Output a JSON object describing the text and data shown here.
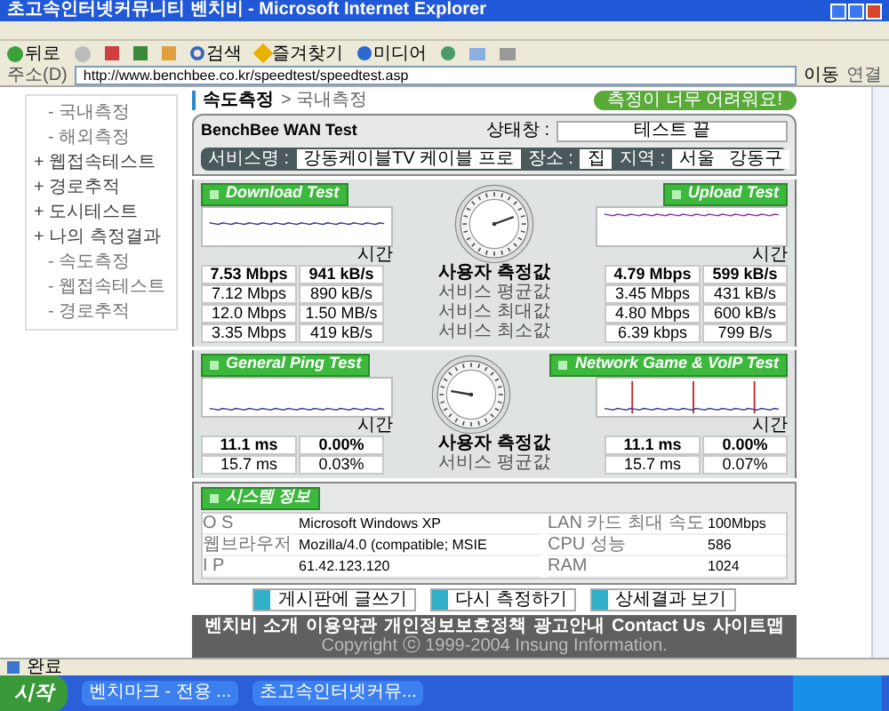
{
  "window": {
    "title": "초고속인터넷커뮤니티 벤치비 - Microsoft Internet Explorer"
  },
  "toolbar": {
    "back": "뒤로",
    "search": "검색",
    "favorites": "즐겨찾기",
    "media": "미디어"
  },
  "address": {
    "label": "주소(D)",
    "url": "http://www.benchbee.co.kr/speedtest/speedtest.asp",
    "go": "이동",
    "links": "연결"
  },
  "sidebar": {
    "items": [
      {
        "label": "- 국내측정",
        "kind": "sub"
      },
      {
        "label": "- 해외측정",
        "kind": "sub"
      },
      {
        "label": "+ 웹접속테스트",
        "kind": "section"
      },
      {
        "label": "+ 경로추적",
        "kind": "section"
      },
      {
        "label": "+ 도시테스트",
        "kind": "section"
      },
      {
        "label": "+ 나의 측정결과",
        "kind": "section"
      },
      {
        "label": "- 속도측정",
        "kind": "sub"
      },
      {
        "label": "- 웹접속테스트",
        "kind": "sub"
      },
      {
        "label": "- 경로추적",
        "kind": "sub"
      }
    ]
  },
  "breadcrumb": {
    "section": "속도측정",
    "current": "> 국내측정"
  },
  "help_button": "측정이 너무 어려워요!",
  "wan_test": {
    "title": "BenchBee WAN Test",
    "status_label": "상태창 :",
    "status": "테스트 끝",
    "service_label": "서비스명 :",
    "service": "강동케이블TV 케이블 프로",
    "place_label": "장소 :",
    "place": "집",
    "region_label": "지역 :",
    "city": "서울",
    "district": "강동구"
  },
  "speed": {
    "left_tab": "Download Test",
    "right_tab": "Upload Test",
    "x_label_left": "시간",
    "x_label_right": "시간",
    "rows": [
      {
        "left_a": "7.53 Mbps",
        "left_b": "941 kB/s",
        "label": "사용자 측정값",
        "right_a": "4.79 Mbps",
        "right_b": "599 kB/s",
        "emphasis": true
      },
      {
        "left_a": "7.12 Mbps",
        "left_b": "890 kB/s",
        "label": "서비스 평균값",
        "right_a": "3.45 Mbps",
        "right_b": "431 kB/s",
        "emphasis": false
      },
      {
        "left_a": "12.0 Mbps",
        "left_b": "1.50 MB/s",
        "label": "서비스 최대값",
        "right_a": "4.80 Mbps",
        "right_b": "600 kB/s",
        "emphasis": false
      },
      {
        "left_a": "3.35 Mbps",
        "left_b": "419 kB/s",
        "label": "서비스 최소값",
        "right_a": "6.39 kbps",
        "right_b": "799 B/s",
        "emphasis": false
      }
    ]
  },
  "ping": {
    "left_tab": "General Ping Test",
    "right_tab": "Network Game & VoIP Test",
    "x_label_left": "시간",
    "x_label_right": "시간",
    "rows": [
      {
        "left_a": "11.1 ms",
        "left_b": "0.00%",
        "label": "사용자 측정값",
        "right_a": "11.1 ms",
        "right_b": "0.00%",
        "emphasis": true
      },
      {
        "left_a": "15.7 ms",
        "left_b": "0.03%",
        "label": "서비스 평균값",
        "right_a": "15.7 ms",
        "right_b": "0.07%",
        "emphasis": false
      }
    ]
  },
  "system": {
    "title": "시스템 정보",
    "rows": [
      {
        "label": "O S",
        "value": "Microsoft Windows XP",
        "label2": "LAN 카드 최대 속도",
        "value2": "100Mbps"
      },
      {
        "label": "웹브라우저",
        "value": "Mozilla/4.0 (compatible; MSIE",
        "label2": "CPU 성능",
        "value2": "586"
      },
      {
        "label": "I P",
        "value": "61.42.123.120",
        "label2": "RAM",
        "value2": "1024"
      }
    ]
  },
  "actions": [
    "게시판에 글쓰기",
    "다시 측정하기",
    "상세결과 보기"
  ],
  "footer": {
    "links": [
      "벤치비 소개",
      "이용약관",
      "개인정보보호정책",
      "광고안내",
      "Contact Us",
      "사이트맵"
    ],
    "copyright": "Copyright ⓒ 1999-2004 Insung Information."
  },
  "status_bar": {
    "text": "완료"
  },
  "taskbar": {
    "start": "시작",
    "tasks": [
      "벤치마크 - 전용 ...",
      "초고속인터넷커뮤..."
    ]
  }
}
